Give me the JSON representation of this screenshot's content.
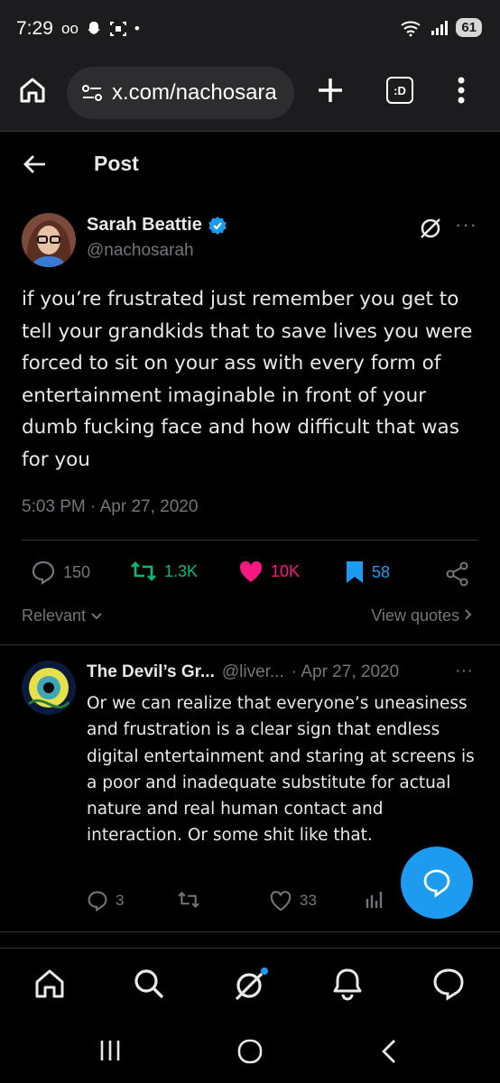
{
  "status_bar": {
    "time": "7:29",
    "battery": "61"
  },
  "browser": {
    "url": "x.com/nachosara",
    "tabs_label": ":D"
  },
  "header": {
    "title": "Post"
  },
  "post": {
    "author_name": "Sarah Beattie",
    "author_handle": "@nachosarah",
    "text": "if you’re frustrated just remember you get to tell your grandkids that to save lives you were forced to sit on your ass with every form of entertainment imaginable in front of your dumb fucking face and how difficult that was for you",
    "timestamp": "5:03 PM · Apr 27, 2020",
    "replies": "150",
    "reposts": "1.3K",
    "likes": "10K",
    "bookmarks": "58",
    "sort_label": "Relevant",
    "view_quotes": "View quotes"
  },
  "reply": {
    "author_name": "The Devil’s Gr...",
    "author_handle": "@liver...",
    "date": "· Apr 27, 2020",
    "text": "Or we can realize that everyone’s uneasiness and frustration is a clear sign that endless digital entertainment and staring at screens is a poor and inadequate substitute for actual nature and real human contact and interaction.  Or some shit like that.",
    "replies": "3",
    "likes": "33"
  },
  "colors": {
    "accent": "#1d9bf0",
    "repost": "#00ba7c",
    "like": "#f91880",
    "muted": "#71767b"
  }
}
